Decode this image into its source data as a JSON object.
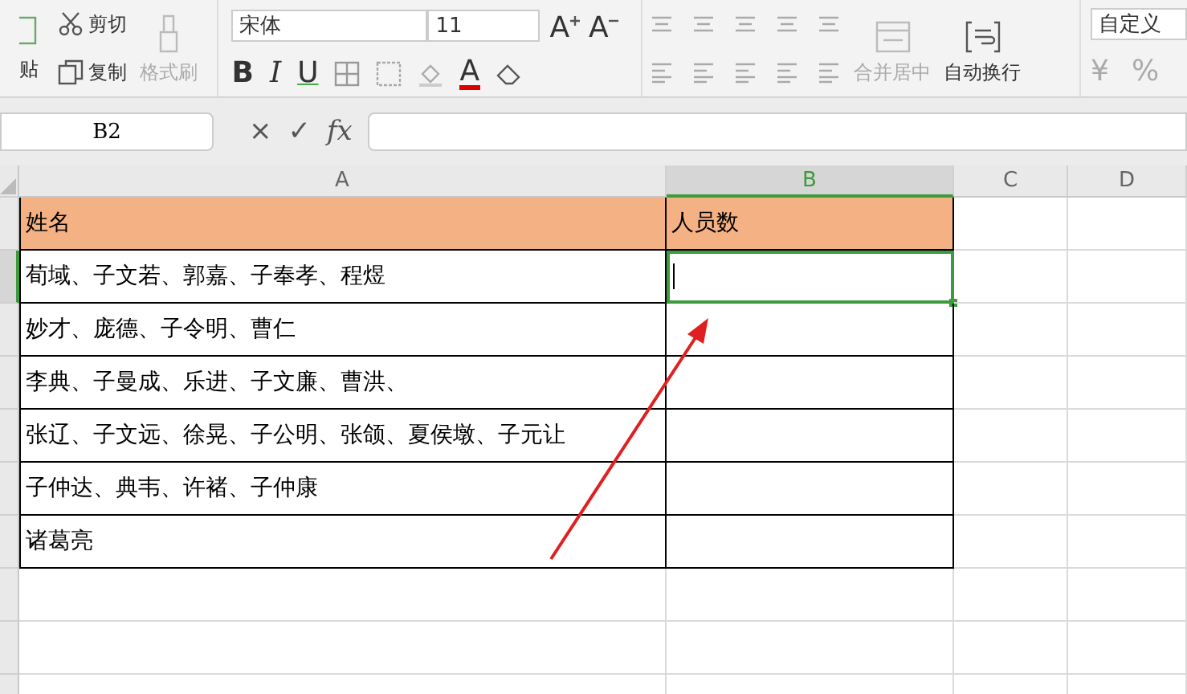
{
  "ribbon": {
    "paste": "贴",
    "cut": "剪切",
    "copy": "复制",
    "format_painter": {
      "label": "格式刷",
      "disabled": true
    },
    "font_name": "宋体",
    "font_size": "11",
    "size_buttons": [
      {
        "kind": "grow",
        "glyph": "A"
      },
      {
        "kind": "shrink",
        "glyph": "A"
      }
    ],
    "style_buttons": [
      {
        "kind": "bold",
        "glyph": "B"
      },
      {
        "kind": "italic",
        "glyph": "I"
      },
      {
        "kind": "underline",
        "glyph": "U"
      }
    ],
    "font_color_glyph": "A",
    "merge": {
      "label": "合并居中",
      "disabled": true
    },
    "wrap": {
      "label": "自动换行",
      "disabled": false
    },
    "number_format": "自定义",
    "currency_glyph": "¥",
    "percent_glyph": "%"
  },
  "formula_bar": {
    "name_box": "B2",
    "cancel_glyph": "×",
    "confirm_glyph": "✓",
    "function_glyph": "fx"
  },
  "sheet": {
    "columns": [
      {
        "label": "A",
        "selected": false
      },
      {
        "label": "B",
        "selected": true
      },
      {
        "label": "C",
        "selected": false
      },
      {
        "label": "D",
        "selected": false
      }
    ],
    "rows": [
      {
        "kind": "header",
        "cells": [
          {
            "text": "姓名",
            "selected": false
          },
          {
            "text": "人员数",
            "selected": false
          }
        ]
      },
      {
        "kind": "data",
        "cells": [
          {
            "text": "荀域、子文若、郭嘉、子奉孝、程煜",
            "selected": false
          },
          {
            "selected": true
          }
        ]
      },
      {
        "kind": "data",
        "cells": [
          {
            "text": "妙才、庞德、子令明、曹仁",
            "selected": false
          },
          {
            "selected": false
          }
        ]
      },
      {
        "kind": "data",
        "cells": [
          {
            "text": "李典、子曼成、乐进、子文廉、曹洪、",
            "selected": false
          },
          {
            "selected": false
          }
        ]
      },
      {
        "kind": "data",
        "cells": [
          {
            "text": "张辽、子文远、徐晃、子公明、张颌、夏侯墩、子元让",
            "selected": false
          },
          {
            "selected": false
          }
        ]
      },
      {
        "kind": "data",
        "cells": [
          {
            "text": "子仲达、典韦、许褚、子仲康",
            "selected": false
          },
          {
            "selected": false
          }
        ]
      },
      {
        "kind": "data",
        "cells": [
          {
            "text": "诸葛亮",
            "selected": false
          },
          {
            "selected": false
          }
        ]
      }
    ]
  }
}
